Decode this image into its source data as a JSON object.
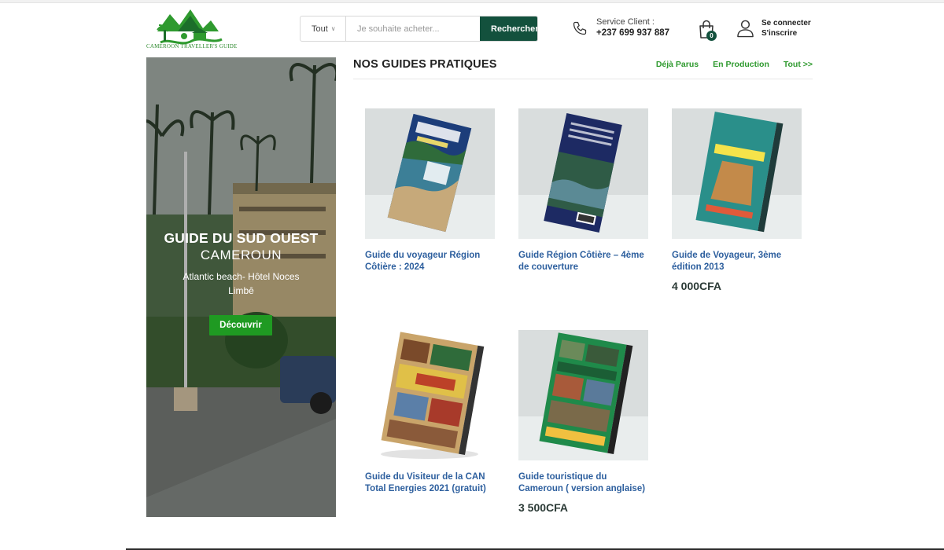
{
  "header": {
    "logo_text": "CAMEROON TRAVELLER'S GUIDE",
    "search": {
      "category": "Tout",
      "placeholder": "Je souhaite acheter...",
      "button_label": "Rechercher"
    },
    "service": {
      "label": "Service Client :",
      "phone": "+237 699 937 887"
    },
    "cart_count": "0",
    "account": {
      "login": "Se connecter",
      "register": "S'inscrire"
    }
  },
  "banner": {
    "title": "GUIDE DU SUD OUEST",
    "subtitle": "CAMEROUN",
    "description": "Atlantic beach- Hôtel Noces Limbê",
    "button_label": "Découvrir"
  },
  "section": {
    "title": "NOS GUIDES PRATIQUES",
    "links": [
      "Déjà Parus",
      "En Production",
      "Tout >>"
    ]
  },
  "products": [
    {
      "name": "Guide du voyageur Région Côtière : 2024",
      "price": "",
      "cover": "cover-coastal"
    },
    {
      "name": "Guide Région Côtière – 4ème de couverture",
      "price": "",
      "cover": "cover-back"
    },
    {
      "name": "Guide de Voyageur, 3ème édition 2013",
      "price": "4 000CFA",
      "cover": "cover-practical"
    },
    {
      "name": "Guide du Visiteur de la CAN Total Energies 2021 (gratuit)",
      "price": "",
      "cover": "cover-can"
    },
    {
      "name": "Guide touristique du Cameroun ( version anglaise)",
      "price": "3 500CFA",
      "cover": "cover-tourist"
    }
  ],
  "colors": {
    "primary_dark_green": "#13513d",
    "link_green": "#2f9a2f",
    "button_green": "#1f9a22",
    "product_link_blue": "#2d5f9e"
  }
}
